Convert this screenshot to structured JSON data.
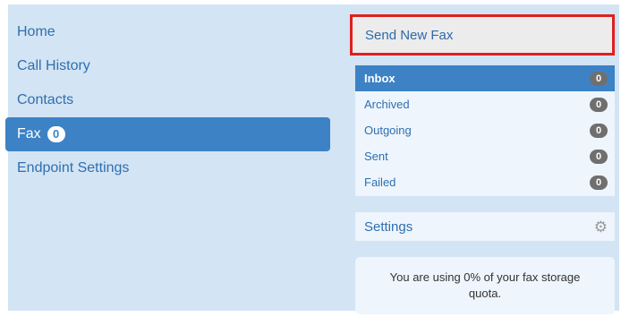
{
  "nav": {
    "items": [
      {
        "label": "Home"
      },
      {
        "label": "Call History"
      },
      {
        "label": "Contacts"
      },
      {
        "label": "Fax",
        "badge": "0"
      },
      {
        "label": "Endpoint Settings"
      }
    ]
  },
  "fax": {
    "send_new_label": "Send New Fax",
    "folders": [
      {
        "label": "Inbox",
        "count": "0"
      },
      {
        "label": "Archived",
        "count": "0"
      },
      {
        "label": "Outgoing",
        "count": "0"
      },
      {
        "label": "Sent",
        "count": "0"
      },
      {
        "label": "Failed",
        "count": "0"
      }
    ],
    "settings_label": "Settings",
    "quota_text": "You are using 0% of your fax storage quota."
  },
  "colors": {
    "panel_bg": "#d3e4f4",
    "accent": "#3c82c5",
    "highlight_border": "#e0201d"
  },
  "icons": {
    "settings": "gear-icon"
  }
}
